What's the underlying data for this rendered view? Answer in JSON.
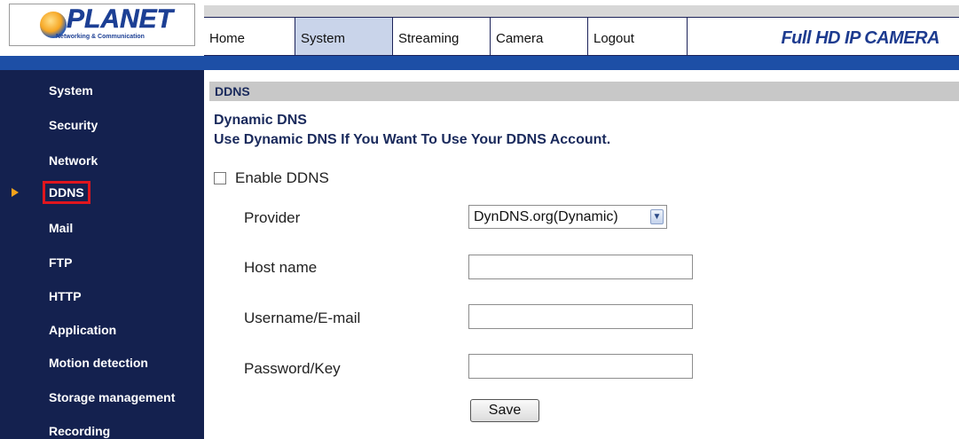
{
  "header": {
    "logo_text": "PLANET",
    "logo_subtitle": "Networking & Communication",
    "brand": "Full HD IP CAMERA",
    "tabs": [
      {
        "label": "Home"
      },
      {
        "label": "System",
        "active": true
      },
      {
        "label": "Streaming"
      },
      {
        "label": "Camera"
      },
      {
        "label": "Logout"
      }
    ]
  },
  "sidebar": {
    "selected": "DDNS",
    "items": [
      {
        "label": "System"
      },
      {
        "label": "Security"
      },
      {
        "label": "Network"
      },
      {
        "label": "DDNS"
      },
      {
        "label": "Mail"
      },
      {
        "label": "FTP"
      },
      {
        "label": "HTTP"
      },
      {
        "label": "Application"
      },
      {
        "label": "Motion detection"
      },
      {
        "label": "Storage management"
      },
      {
        "label": "Recording"
      }
    ]
  },
  "main": {
    "section_title": "DDNS",
    "heading_line1": "Dynamic DNS",
    "heading_line2": "Use Dynamic DNS If You Want To Use Your DDNS Account.",
    "enable_label": "Enable DDNS",
    "enable_checked": false,
    "provider_label": "Provider",
    "provider_value": "DynDNS.org(Dynamic)",
    "hostname_label": "Host name",
    "hostname_value": "",
    "username_label": "Username/E-mail",
    "username_value": "",
    "password_label": "Password/Key",
    "password_value": "",
    "save_label": "Save"
  },
  "colors": {
    "sidebar_bg": "#14214f",
    "accent_blue": "#1d4fa6",
    "selected_outline": "#e0161e",
    "arrow": "#f5a21b"
  }
}
